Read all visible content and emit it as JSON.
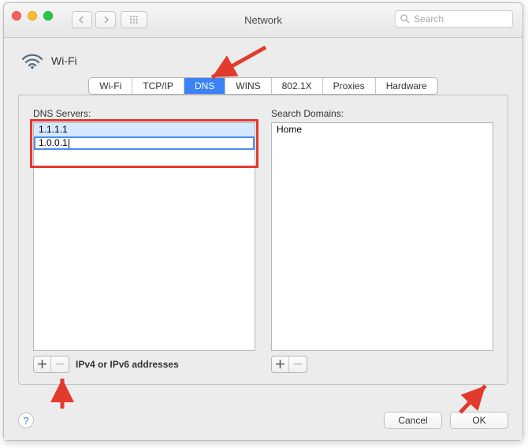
{
  "window": {
    "title": "Network",
    "search_placeholder": "Search"
  },
  "sidebar": {
    "wifi_label": "Wi-Fi"
  },
  "tabs": {
    "items": [
      "Wi-Fi",
      "TCP/IP",
      "DNS",
      "WINS",
      "802.1X",
      "Proxies",
      "Hardware"
    ],
    "active_index": 2
  },
  "dns": {
    "label": "DNS Servers:",
    "servers": [
      "1.1.1.1",
      "1.0.0.1"
    ],
    "editing_index": 1,
    "hint": "IPv4 or IPv6 addresses"
  },
  "domains": {
    "label": "Search Domains:",
    "items": [
      "Home"
    ]
  },
  "buttons": {
    "cancel": "Cancel",
    "ok": "OK"
  }
}
